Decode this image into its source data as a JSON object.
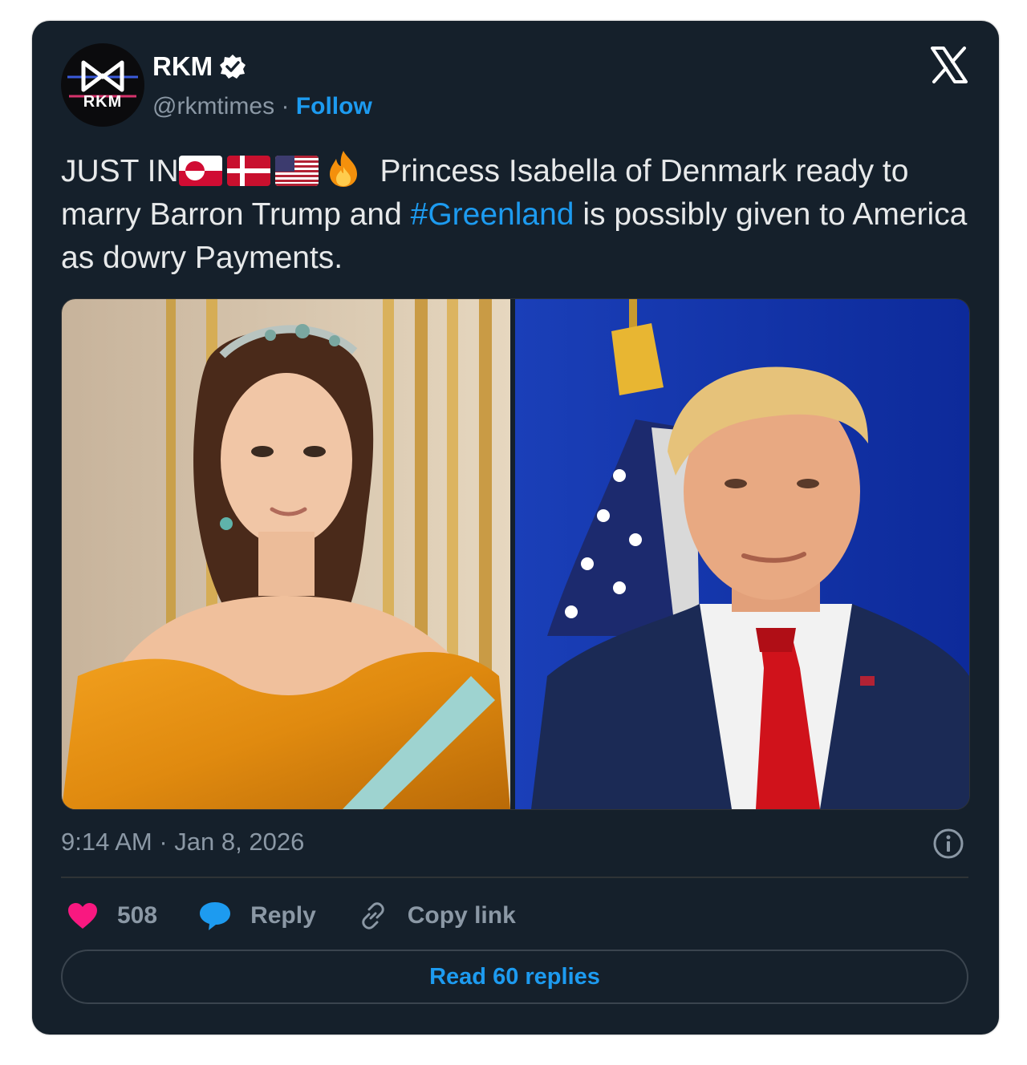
{
  "post": {
    "author_name": "RKM",
    "avatar_text": "RKM",
    "handle": "@rkmtimes",
    "separator": "·",
    "follow_label": "Follow",
    "text_prefix": "JUST IN",
    "text_part1": " Princess Isabella of Denmark ready to marry Barron Trump and ",
    "hashtag": "#Greenland",
    "text_part2": " is possibly given to America as dowry Payments.",
    "timestamp": "9:14 AM · Jan 8, 2026"
  },
  "actions": {
    "likes": "508",
    "reply_label": "Reply",
    "copy_link_label": "Copy link",
    "read_replies_label": "Read 60 replies"
  },
  "icons": [
    "x-logo",
    "verified-badge",
    "greenland-flag",
    "denmark-flag",
    "us-flag",
    "fire-emoji",
    "info-icon",
    "heart-icon",
    "reply-bubble-icon",
    "link-icon"
  ],
  "colors": {
    "background": "#15202b",
    "accent": "#1d9bf0",
    "heart": "#f91880",
    "text": "#e7e9ea",
    "muted": "#8b98a5"
  }
}
